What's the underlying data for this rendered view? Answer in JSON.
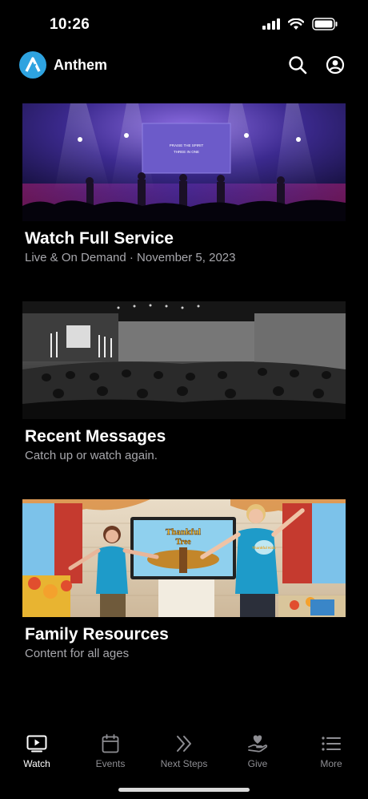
{
  "status": {
    "time": "10:26"
  },
  "app": {
    "name": "Anthem"
  },
  "cards": [
    {
      "title": "Watch Full Service",
      "subtitle": "Live & On Demand · November 5, 2023",
      "screen_text": [
        "PRAISE THE SPIRIT",
        "THREE IN ONE"
      ]
    },
    {
      "title": "Recent Messages",
      "subtitle": "Catch up or watch again."
    },
    {
      "title": "Family Resources",
      "subtitle": "Content for all ages",
      "screen_text": [
        "Thankful",
        "Tree"
      ],
      "shirt_text": "Thankful Kids"
    }
  ],
  "tabs": [
    {
      "label": "Watch",
      "icon": "play-screen-icon",
      "active": true
    },
    {
      "label": "Events",
      "icon": "calendar-icon",
      "active": false
    },
    {
      "label": "Next Steps",
      "icon": "chevrons-right-icon",
      "active": false
    },
    {
      "label": "Give",
      "icon": "heart-hand-icon",
      "active": false
    },
    {
      "label": "More",
      "icon": "menu-list-icon",
      "active": false
    }
  ],
  "colors": {
    "background": "#000000",
    "accent": "#2ea3e0",
    "muted_text": "#a7a7ac",
    "inactive_tab": "#8e8e93"
  }
}
